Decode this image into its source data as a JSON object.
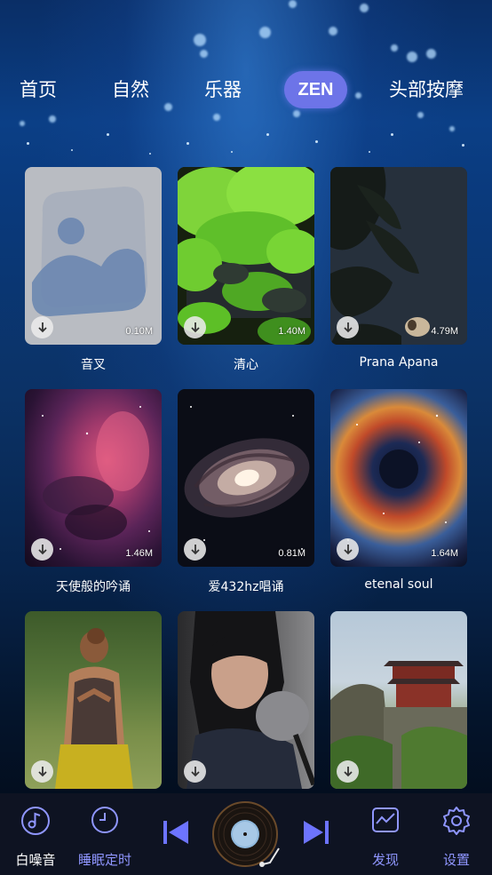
{
  "tabs": [
    {
      "label": "首页",
      "active": false
    },
    {
      "label": "自然",
      "active": false
    },
    {
      "label": "乐器",
      "active": false
    },
    {
      "label": "ZEN",
      "active": true
    },
    {
      "label": "头部按摩",
      "active": false
    }
  ],
  "items": [
    {
      "title": "音叉",
      "size": "0.10M",
      "image": "placeholder-image-icon"
    },
    {
      "title": "清心",
      "size": "1.40M",
      "image": "green-maple-leaves"
    },
    {
      "title": "Prana Apana",
      "size": "4.79M",
      "image": "dark-leaf-silhouette"
    },
    {
      "title": "天使般的吟诵",
      "size": "1.46M",
      "image": "pink-nebula"
    },
    {
      "title": "爱432hz唱诵",
      "size": "0.81M",
      "image": "spiral-galaxy"
    },
    {
      "title": "etenal soul",
      "size": "1.64M",
      "image": "colorful-nebula-eye"
    },
    {
      "title": "",
      "size": "",
      "image": "woman-yoga-pose"
    },
    {
      "title": "",
      "size": "",
      "image": "woman-with-microphone"
    },
    {
      "title": "",
      "size": "",
      "image": "chinese-temple-cliff"
    }
  ],
  "bottom_nav": {
    "white_noise": {
      "label": "白噪音",
      "icon": "music-note-icon"
    },
    "sleep_timer": {
      "label": "睡眠定时",
      "icon": "clock-icon"
    },
    "discover": {
      "label": "发现",
      "icon": "chart-icon"
    },
    "settings": {
      "label": "设置",
      "icon": "gear-icon"
    }
  },
  "player": {
    "prev_icon": "skip-previous-icon",
    "next_icon": "skip-next-icon",
    "disc_icon": "vinyl-disc-icon"
  },
  "colors": {
    "accent": "#6d74e8",
    "nav_active": "#7a86ff",
    "bar_bg": "#0e1322"
  }
}
